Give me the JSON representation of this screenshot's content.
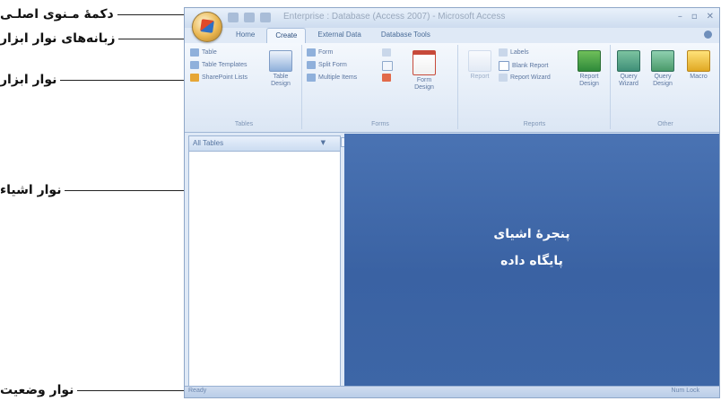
{
  "annotations": {
    "office_button": "دکمهٔ مـنوی اصلـی",
    "ribbon_tabs": "زبانه‌های نوار ابزار",
    "ribbon": "نوار ابزار",
    "object_bar": "نوار اشیاء",
    "status_bar": "نوار وضعیت",
    "pane_line1": "پنجرهٔ اشیای",
    "pane_line2": "پایگاه داده"
  },
  "window": {
    "title": "Enterprise : Database (Access 2007) - Microsoft Access"
  },
  "tabs": [
    "Home",
    "Create",
    "External Data",
    "Database Tools"
  ],
  "ribbon": {
    "tables": {
      "label": "Tables",
      "table": "Table",
      "templates": "Table Templates",
      "sharepoint": "SharePoint Lists",
      "design": "Table Design"
    },
    "forms": {
      "label": "Forms",
      "form": "Form",
      "split": "Split Form",
      "multiple": "Multiple Items",
      "design": "Form Design"
    },
    "reports": {
      "label": "Reports",
      "report": "Report",
      "labels": "Labels",
      "blank": "Blank Report",
      "wizard": "Report Wizard",
      "design": "Report Design"
    },
    "other": {
      "label": "Other",
      "wizard": "Query Wizard",
      "design": "Query Design",
      "macro": "Macro"
    }
  },
  "nav": {
    "header": "All Tables"
  },
  "status": {
    "left": "Ready",
    "right": "Num Lock"
  }
}
